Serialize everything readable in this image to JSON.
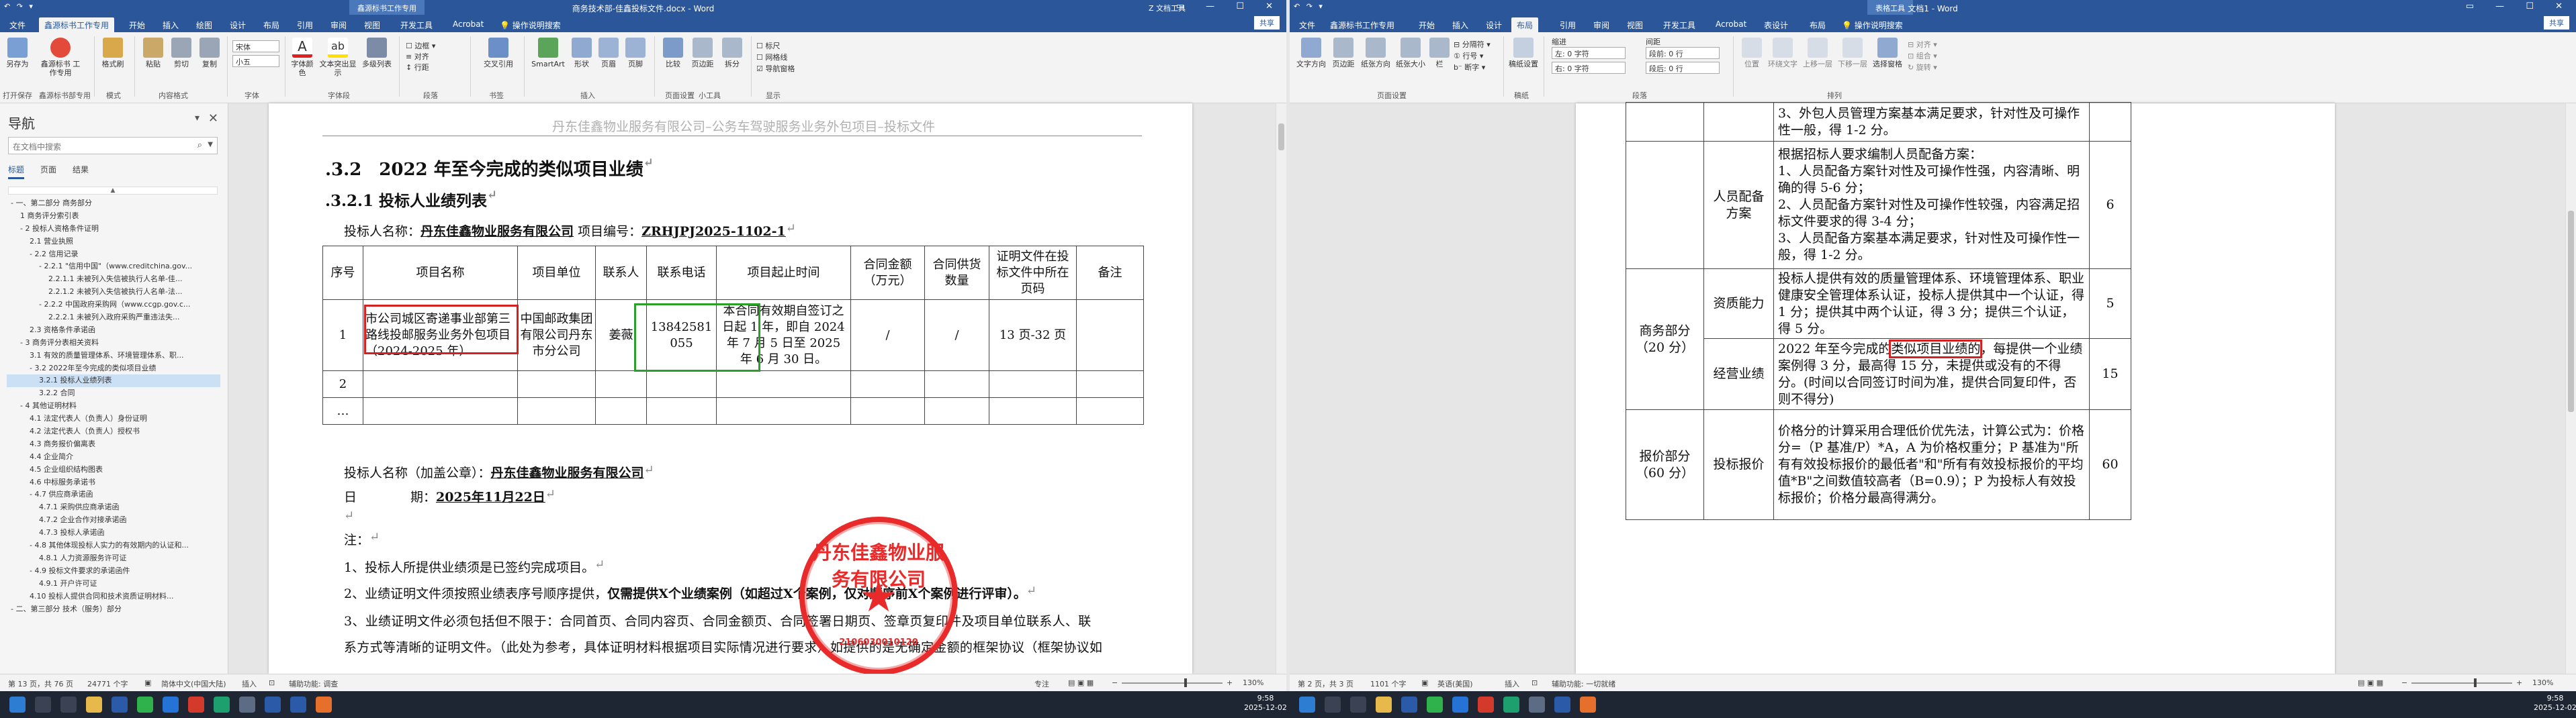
{
  "left": {
    "title": "商务技术部-佳鑫投标文件.docx - Word",
    "user": "Z 文档工具",
    "quick_access": "↶ ↷ ▾",
    "context_tab": "鑫源标书工作专用",
    "tabs": [
      "文件",
      "开始",
      "插入",
      "绘图",
      "设计",
      "布局",
      "引用",
      "审阅",
      "视图",
      "开发工具",
      "Acrobat",
      "操作说明搜索"
    ],
    "share": "共享",
    "ribbon": {
      "buttons": [
        {
          "label": "另存为"
        },
        {
          "label": "鑫源标书\n工作专用"
        },
        {
          "label": "格式刷"
        },
        {
          "label": "粘贴"
        },
        {
          "label": "剪切"
        },
        {
          "label": "复制"
        },
        {
          "label": "字体颜色"
        },
        {
          "label": "文本突出显示"
        },
        {
          "label": "多级列表"
        },
        {
          "label": "交叉引用"
        },
        {
          "label": "SmartArt"
        },
        {
          "label": "形状"
        },
        {
          "label": "页眉"
        },
        {
          "label": "页脚"
        },
        {
          "label": "比较"
        },
        {
          "label": "页边距"
        },
        {
          "label": "拆分"
        }
      ],
      "groups": [
        "打开保存",
        "鑫源标书部专用",
        "模式",
        "内容格式",
        "字体",
        "字体段",
        "段落",
        "书签",
        "插入",
        "页面设置",
        "小工具",
        "显示"
      ],
      "font_name": "宋体",
      "font_size": "小五",
      "checks": [
        "标尺",
        "网格线",
        "导航窗格"
      ]
    },
    "nav": {
      "title": "导航",
      "search_placeholder": "在文档中搜索",
      "tabs": [
        "标题",
        "页面",
        "结果"
      ],
      "tree": [
        "- 一、第二部分 商务部分",
        "1 商务评分索引表",
        "- 2 投标人资格条件证明",
        "2.1 营业执照",
        "- 2.2 信用记录",
        "- 2.2.1 \"信用中国\"（www.creditchina.gov...",
        "2.2.1.1 未被列入失信被执行人名单-佳...",
        "2.2.1.2 未被列入失信被执行人名单-法...",
        "- 2.2.2 中国政府采购网（www.ccgp.gov.c...",
        "2.2.2.1 未被列入政府采购严重违法失...",
        "2.3 资格条件承诺函",
        "- 3 商务评分表相关资料",
        "3.1 有效的质量管理体系、环境管理体系、职...",
        "- 3.2 2022年至今完成的类似项目业绩",
        "3.2.1 投标人业绩列表",
        "3.2.2 合同",
        "- 4 其他证明材料",
        "4.1 法定代表人（负责人）身份证明",
        "4.2 法定代表人（负责人）授权书",
        "4.3 商务报价偏离表",
        "4.4 企业简介",
        "4.5 企业组织结构图表",
        "4.6 中标服务承诺书",
        "- 4.7 供应商承诺函",
        "4.7.1 采购供应商承诺函",
        "4.7.2 企业合作对接承诺函",
        "4.7.3 投标人承诺函",
        "- 4.8 其他体现投标人实力的有效期内的认证和...",
        "4.8.1 人力资源服务许可证",
        "- 4.9 投标文件要求的承诺函件",
        "4.9.1 开户许可证",
        "4.10 投标人提供合同和技术资质证明材料...",
        "- 二、第三部分 技术（服务）部分"
      ],
      "selected_index": 14
    },
    "doc": {
      "header": "丹东佳鑫物业服务有限公司–公务车驾驶服务业务外包项目–投标文件",
      "h2": ".3.2　2022 年至今完成的类似项目业绩",
      "h3": ".3.2.1 投标人业绩列表",
      "bidder_label": "投标人名称：",
      "bidder_name": "丹东佳鑫物业服务有限公司",
      "proj_no_label": "项目编号：",
      "proj_no": "ZRHJPJ2025-1102-1",
      "table_headers": [
        "序号",
        "项目名称",
        "项目单位",
        "联系人",
        "联系电话",
        "项目起止时间",
        "合同金额（万元）",
        "合同供货数量",
        "证明文件在投标文件中所在页码",
        "备注"
      ],
      "row1": {
        "no": "1",
        "name": "市公司城区寄递事业部第三路线投邮服务业务外包项目（2024-2025 年）",
        "unit": "中国邮政集团有限公司丹东市分公司",
        "contact": "姜薇",
        "phone": "13842581055",
        "period": "本合同有效期自签订之日起 1 年，即自 2024 年 7 月 5 日至 2025 年 6 月 30 日。",
        "amount": "/",
        "qty": "/",
        "pages": "13 页-32 页",
        "remark": ""
      },
      "row2_no": "2",
      "row3_no": "…",
      "sign_label": "投标人名称（加盖公章）：",
      "sign_name": "丹东佳鑫物业服务有限公司",
      "date_label1": "日",
      "date_label2": "期：",
      "date_value": "2025年11月22日",
      "notes_label": "注：",
      "note1": "1、投标人所提供业绩须是已签约完成项目。",
      "note2a": "2、业绩证明文件须按照业绩表序号顺序提供，",
      "note2b": "仅需提供X个业绩案例（如超过X个案例，仅对顺序前X个案例进行评审）。",
      "note3a": "3、业绩证明文件必须包括但不限于：合同首页、合同内容页、合同金额页、合同签署日期页、签章页复印件及项目单位联系人、联",
      "note3b": "系方式等清晰的证明文件。（此处为参考，具体证明材料根据项目实际情况进行要求）如提供的是无确定金额的框架协议（框架协议如",
      "seal_text": "丹东佳鑫物业服务有限公司",
      "seal_code": "2106030010120",
      "mark": "↵"
    },
    "status": {
      "page": "第 13 页，共 76 页",
      "words": "24771 个字",
      "lang": "简体中文(中国大陆)",
      "insert": "插入",
      "mode": "辅助功能: 调查",
      "focus": "专注",
      "zoom": "130%"
    }
  },
  "right": {
    "title": "文档1 - Word",
    "context_tab": "表格工具",
    "tabs": [
      "文件",
      "鑫源标书工作专用",
      "开始",
      "插入",
      "设计",
      "布局",
      "引用",
      "审阅",
      "视图",
      "开发工具",
      "Acrobat",
      "表设计",
      "布局",
      "操作说明搜索"
    ],
    "active_tab": "布局",
    "share": "共享",
    "ribbon": {
      "buttons": [
        {
          "label": "文字方向"
        },
        {
          "label": "页边距"
        },
        {
          "label": "纸张方向"
        },
        {
          "label": "纸张大小"
        },
        {
          "label": "栏"
        },
        {
          "label": "稿纸设置"
        },
        {
          "label": "位置"
        },
        {
          "label": "环绕文字"
        },
        {
          "label": "上移一层"
        },
        {
          "label": "下移一层"
        },
        {
          "label": "选择窗格"
        }
      ],
      "groups": [
        "页面设置",
        "稿纸",
        "段落",
        "排列"
      ],
      "indent": "缩进",
      "spacing": "间距",
      "indent_left": "左: 0 字符",
      "indent_right": "右: 0 字符",
      "space_before": "段前: 0 行",
      "space_after": "段后: 0 行",
      "align": "对齐",
      "group": "组合",
      "rotate": "旋转"
    },
    "table": {
      "r0": "3、外包人员管理方案基本满足要求，针对性及可操作性一般，得 1-2 分。",
      "r1_name": "人员配备方案",
      "r1_text": "根据招标人要求编制人员配备方案：\n1、人员配备方案针对性及可操作性强，内容清晰、明确的得 5-6 分；\n2、人员配备方案针对性及可操作性较强，内容满足招标文件要求的得 3-4 分；\n3、人员配备方案基本满足要求，针对性及可操作性一般，得 1-2 分。",
      "r1_score": "6",
      "group_name": "商务部分（20 分）",
      "r2_name": "资质能力",
      "r2_text": "投标人提供有效的质量管理体系、环境管理体系、职业健康安全管理体系认证，投标人提供其中一个认证，得 1 分；提供其中两个认证，得 3 分；提供三个认证，得 5 分。",
      "r2_score": "5",
      "r3_name": "经营业绩",
      "r3_pre": "2022 年至今完成的",
      "r3_hl": "类似项目业绩的",
      "r3_post": "，每提供一个业绩案例得 3 分，最高得 15 分，未提供或没有的不得分。(时间以合同签订时间为准，提供合同复印件，否则不得分)",
      "r3_score": "15",
      "price_group": "报价部分（60 分）",
      "r4_name": "投标报价",
      "r4_text": "价格分的计算采用合理低价优先法，计算公式为：价格分=（P 基准/P）*A，A 为价格权重分；P 基准为\"所有有效投标报价的最低者\"和\"所有有效投标报价的平均值*B\"之间数值较高者（B=0.9）；P 为投标人有效投标报价；价格分最高得满分。",
      "r4_score": "60"
    },
    "status": {
      "page": "第 2 页，共 3 页",
      "words": "1101 个字",
      "lang": "英语(美国)",
      "insert": "插入",
      "mode": "辅助功能: 一切就绪",
      "zoom": "130%"
    }
  },
  "taskbar": {
    "time_left": "9:58",
    "date_left": "2025-12-02",
    "time_right": "9:58",
    "date_right": "2025-12-02"
  }
}
